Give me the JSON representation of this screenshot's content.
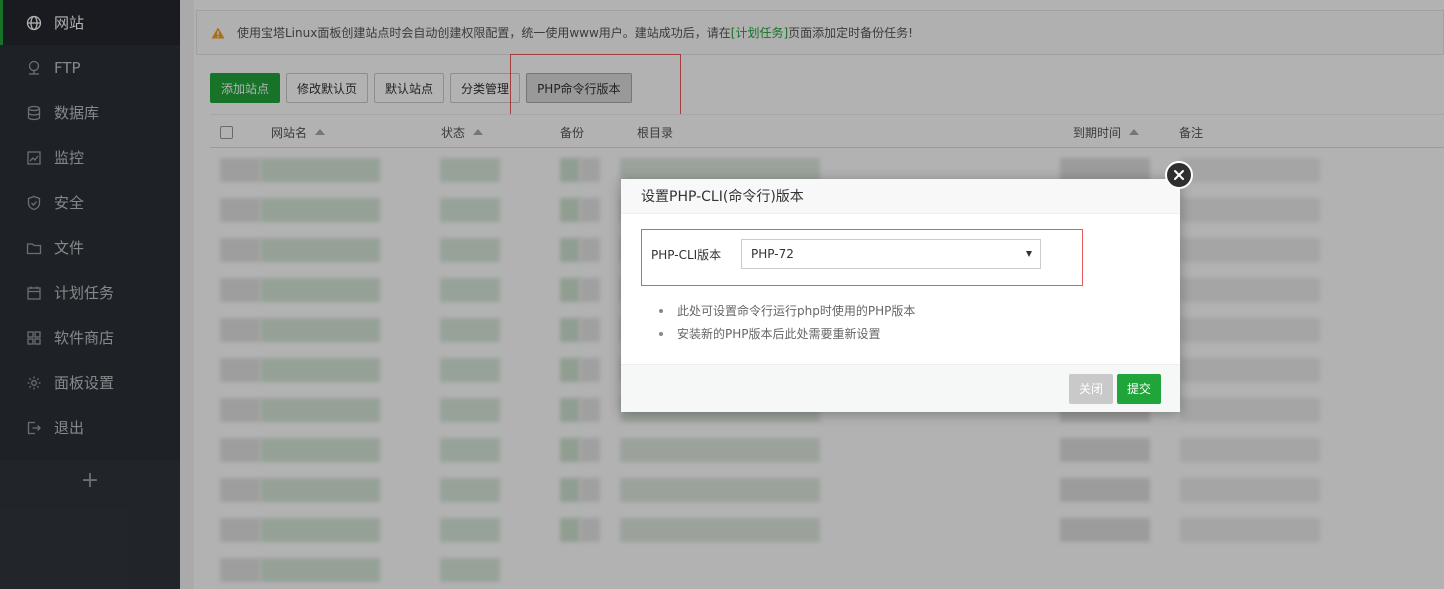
{
  "sidebar": {
    "items": [
      {
        "label": "网站",
        "icon": "globe-icon",
        "active": true
      },
      {
        "label": "FTP",
        "icon": "ftp-icon"
      },
      {
        "label": "数据库",
        "icon": "database-icon"
      },
      {
        "label": "监控",
        "icon": "monitor-icon"
      },
      {
        "label": "安全",
        "icon": "shield-icon"
      },
      {
        "label": "文件",
        "icon": "folder-icon"
      },
      {
        "label": "计划任务",
        "icon": "calendar-icon"
      },
      {
        "label": "软件商店",
        "icon": "grid-icon"
      },
      {
        "label": "面板设置",
        "icon": "gear-icon"
      },
      {
        "label": "退出",
        "icon": "logout-icon"
      }
    ],
    "add_label": "+"
  },
  "alert": {
    "text_before": "使用宝塔Linux面板创建站点时会自动创建权限配置，统一使用www用户。建站成功后，请在",
    "link": "[计划任务]",
    "text_after": "页面添加定时备份任务!"
  },
  "toolbar": {
    "add_site": "添加站点",
    "edit_default_page": "修改默认页",
    "default_site": "默认站点",
    "category_manage": "分类管理",
    "php_cli_version": "PHP命令行版本"
  },
  "table": {
    "headers": {
      "name": "网站名",
      "status": "状态",
      "backup": "备份",
      "root": "根目录",
      "expire": "到期时间",
      "note": "备注"
    }
  },
  "modal": {
    "title": "设置PHP-CLI(命令行)版本",
    "field_label": "PHP-CLI版本",
    "selected_version": "PHP-72",
    "tips": [
      "此处可设置命令行运行php时使用的PHP版本",
      "安装新的PHP版本后此处需要重新设置"
    ],
    "close_label": "关闭",
    "submit_label": "提交"
  },
  "colors": {
    "accent": "#20a53a",
    "sidebar_bg": "#2c3138",
    "highlight": "#e8595a"
  }
}
